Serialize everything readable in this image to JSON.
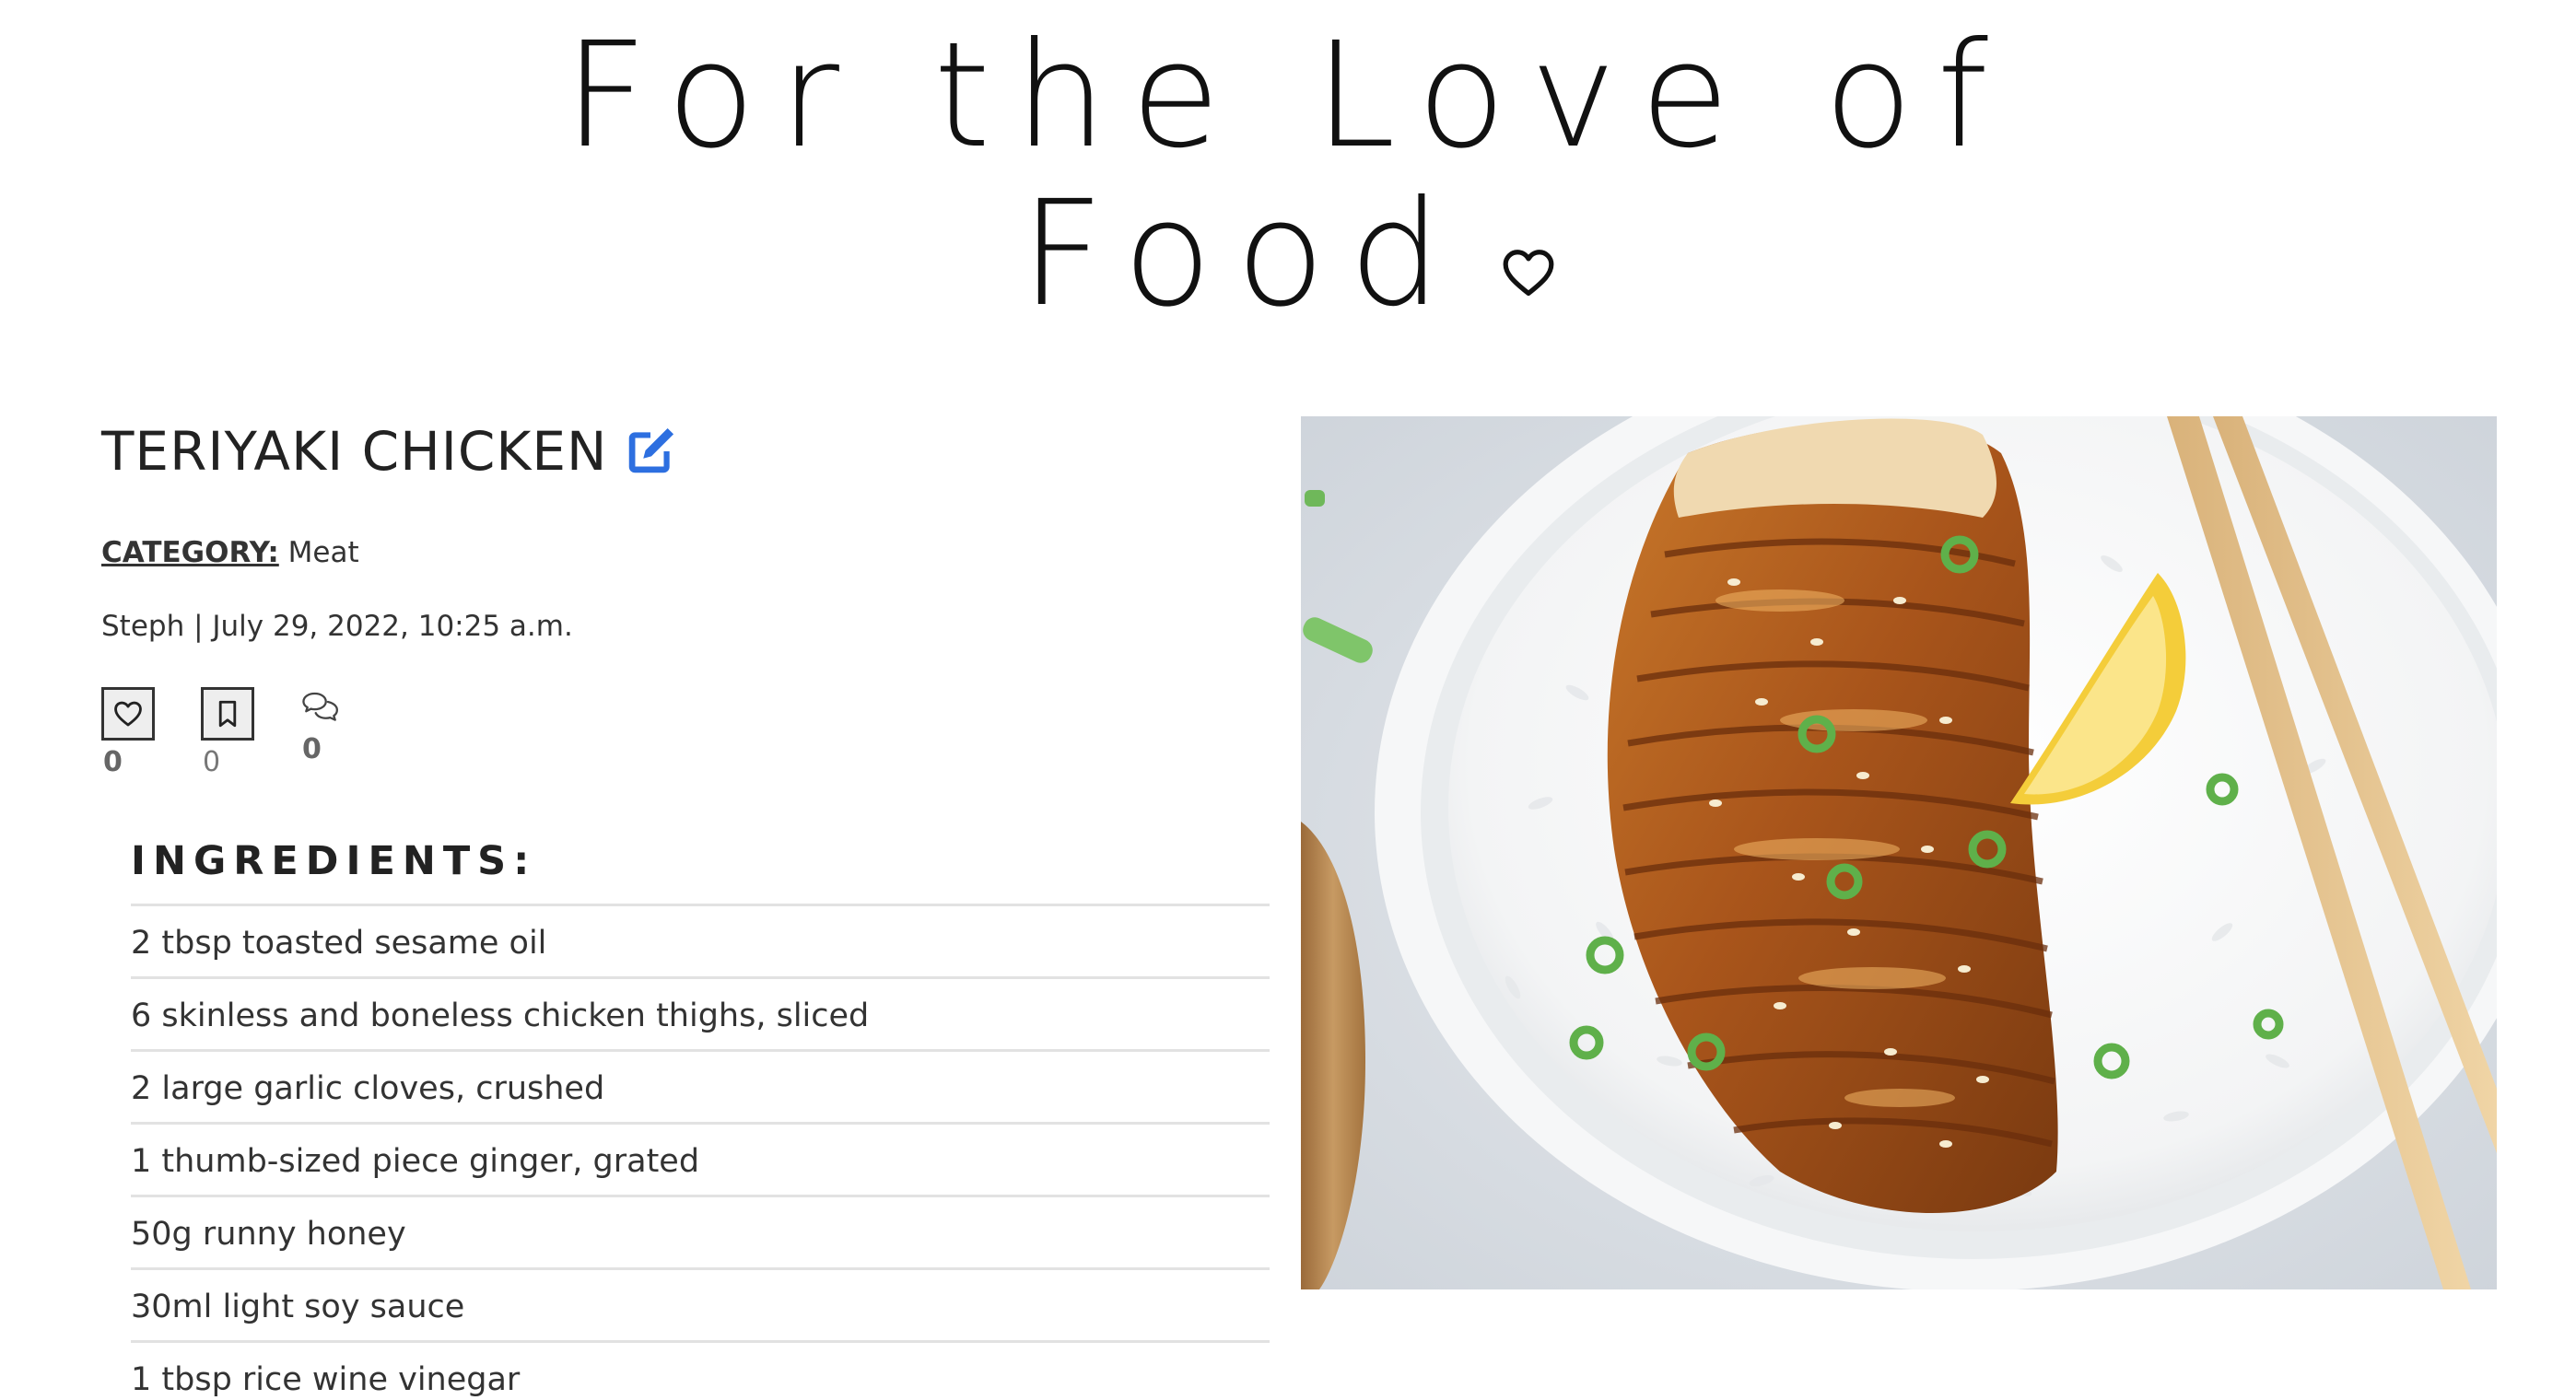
{
  "site": {
    "title_line1": "For the Love of",
    "title_line2": "Food"
  },
  "recipe": {
    "title": "TERIYAKI CHICKEN",
    "category_label": "CATEGORY:",
    "category_value": " Meat",
    "meta": "Steph | July 29, 2022, 10:25 a.m.",
    "likes_count": "0",
    "saves_count": "0",
    "comments_count": "0"
  },
  "ingredients": {
    "heading": "INGREDIENTS:",
    "items": [
      "2 tbsp toasted sesame oil",
      "6 skinless and boneless chicken thighs, sliced",
      "2 large garlic cloves, crushed",
      "1 thumb-sized piece ginger, grated",
      "50g runny honey",
      "30ml light soy sauce",
      "1 tbsp rice wine vinegar"
    ]
  },
  "icons": {
    "title_heart": "heart-outline-icon",
    "edit": "edit-square-icon",
    "like": "heart-icon",
    "save": "bookmark-icon",
    "comment": "chat-bubbles-icon"
  },
  "colors": {
    "edit_icon": "#2d6fe0",
    "text": "#222222",
    "divider": "#e2e2e2"
  }
}
